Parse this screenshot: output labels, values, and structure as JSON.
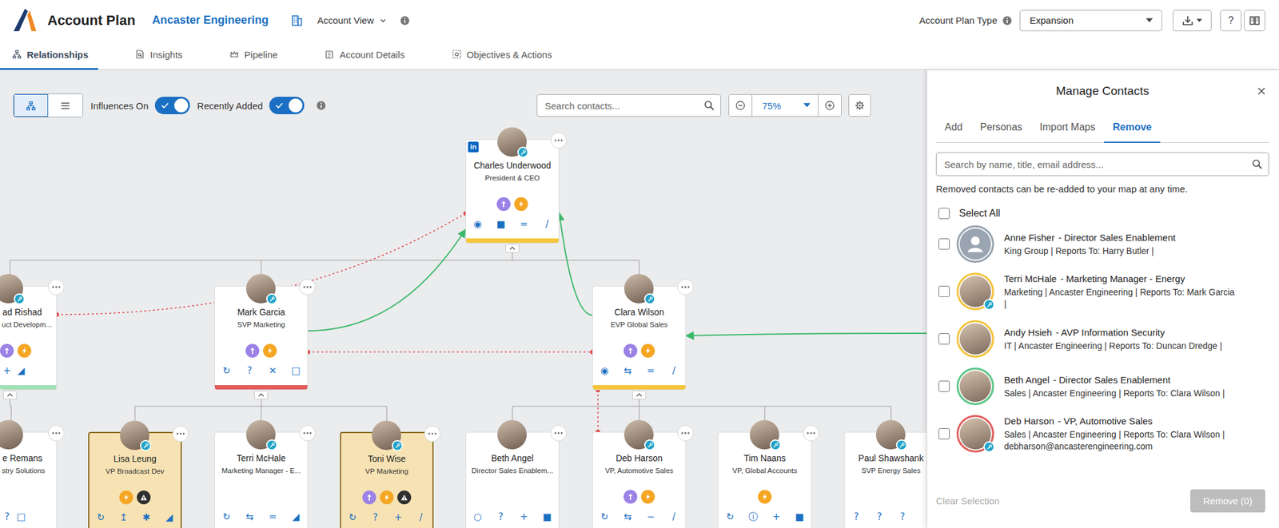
{
  "header": {
    "title": "Account Plan",
    "account": "Ancaster Engineering",
    "view": "Account View",
    "planTypeLabel": "Account Plan Type",
    "planType": "Expansion",
    "help": "?"
  },
  "tabs": [
    {
      "label": "Relationships",
      "selected": true
    },
    {
      "label": "Insights",
      "selected": false
    },
    {
      "label": "Pipeline",
      "selected": false
    },
    {
      "label": "Account Details",
      "selected": false
    },
    {
      "label": "Objectives & Actions",
      "selected": false
    }
  ],
  "toolbar": {
    "views": [
      {
        "kind": "tree",
        "selected": true
      },
      {
        "kind": "list",
        "selected": false
      }
    ],
    "toggles": [
      {
        "label": "Influences On",
        "on": true
      },
      {
        "label": "Recently Added",
        "on": true
      }
    ],
    "search": {
      "placeholder": "Search contacts..."
    },
    "zoom": "75%"
  },
  "canvas": {
    "nodes": [
      {
        "name": "Charles Underwood",
        "title": "President & CEO",
        "linkedin": "in",
        "key": true,
        "recent": false,
        "parent": null,
        "expanded": true,
        "badges": [
          "influence",
          "energy"
        ],
        "actions": [
          "◉",
          "■",
          "=",
          "/"
        ],
        "color": "#f5c63c"
      },
      {
        "name": "ad Rishad",
        "title": "uct Developm...",
        "linkedin": "",
        "key": true,
        "recent": false,
        "parent": 0,
        "expanded": true,
        "badges": [
          "influence",
          "energy"
        ],
        "actions": [
          "+",
          "◢"
        ],
        "color": "#9fe0b4"
      },
      {
        "name": "Mark Garcia",
        "title": "SVP Marketing",
        "linkedin": "",
        "key": true,
        "recent": false,
        "parent": 0,
        "expanded": true,
        "badges": [
          "influence",
          "energy"
        ],
        "actions": [
          "↻",
          "?",
          "✕",
          "□"
        ],
        "color": "#e35d5d"
      },
      {
        "name": "Clara Wilson",
        "title": "EVP Global Sales",
        "linkedin": "",
        "key": true,
        "recent": false,
        "parent": 0,
        "expanded": true,
        "badges": [
          "influence",
          "energy"
        ],
        "actions": [
          "◉",
          "⇆",
          "=",
          "/"
        ],
        "color": "#f5c63c"
      },
      {
        "name": "e Remans",
        "title": "stry Solutions",
        "linkedin": "",
        "key": false,
        "recent": false,
        "parent": 1,
        "expanded": false,
        "badges": [],
        "actions": [
          "?",
          "□"
        ],
        "color": ""
      },
      {
        "name": "Lisa Leung",
        "title": "VP Broadcast Dev",
        "linkedin": "",
        "key": true,
        "recent": true,
        "parent": 2,
        "expanded": false,
        "badges": [
          "energy",
          "warning"
        ],
        "actions": [
          "↻",
          "↥",
          "✱",
          "◢"
        ],
        "color": ""
      },
      {
        "name": "Terri McHale",
        "title": "Marketing Manager - E...",
        "linkedin": "",
        "key": true,
        "recent": false,
        "parent": 2,
        "expanded": false,
        "badges": [],
        "actions": [
          "↻",
          "⇆",
          "=",
          "◢"
        ],
        "color": ""
      },
      {
        "name": "Toni Wise",
        "title": "VP Marketing",
        "linkedin": "",
        "key": true,
        "recent": true,
        "parent": 2,
        "expanded": false,
        "badges": [
          "influence",
          "energy",
          "warning"
        ],
        "actions": [
          "↻",
          "?",
          "+",
          "/"
        ],
        "color": ""
      },
      {
        "name": "Beth Angel",
        "title": "Director Sales Enablem...",
        "linkedin": "",
        "key": false,
        "recent": false,
        "parent": 3,
        "expanded": false,
        "badges": [],
        "actions": [
          "○",
          "?",
          "+",
          "■"
        ],
        "color": ""
      },
      {
        "name": "Deb Harson",
        "title": "VP, Automotive Sales",
        "linkedin": "",
        "key": true,
        "recent": false,
        "parent": 3,
        "expanded": false,
        "badges": [
          "influence",
          "energy"
        ],
        "actions": [
          "↻",
          "⇆",
          "−",
          "/"
        ],
        "color": ""
      },
      {
        "name": "Tim Naans",
        "title": "VP, Global Accounts",
        "linkedin": "",
        "key": true,
        "recent": false,
        "parent": 3,
        "expanded": false,
        "badges": [
          "energy"
        ],
        "actions": [
          "↻",
          "ⓘ",
          "+",
          "■"
        ],
        "color": ""
      },
      {
        "name": "Paul Shawshank",
        "title": "SVP Energy Sales",
        "linkedin": "",
        "key": true,
        "recent": false,
        "parent": 3,
        "expanded": false,
        "badges": [],
        "actions": [
          "?",
          "?",
          "?"
        ],
        "color": ""
      }
    ],
    "influences": [
      {
        "from": 1,
        "to": 0,
        "positive": false,
        "color": "#e04848"
      },
      {
        "from": 2,
        "to": 0,
        "positive": true,
        "color": "#3cb96a"
      },
      {
        "from": 3,
        "to": 0,
        "positive": true,
        "color": "#3cb96a"
      },
      {
        "from": 2,
        "to": 3,
        "positive": false,
        "color": "#e04848"
      },
      {
        "from": null,
        "to": 3,
        "positive": true,
        "color": "#3cb96a"
      },
      {
        "from": 3,
        "to": 9,
        "positive": false,
        "color": "#e04848"
      }
    ]
  },
  "panel": {
    "title": "Manage Contacts",
    "tabs": [
      {
        "label": "Add",
        "selected": false
      },
      {
        "label": "Personas",
        "selected": false
      },
      {
        "label": "Import Maps",
        "selected": false
      },
      {
        "label": "Remove",
        "selected": true
      }
    ],
    "search": {
      "placeholder": "Search by name, title, email address..."
    },
    "note": "Removed contacts can be re-added to your map at any time.",
    "selectAll": {
      "label": "Select All",
      "checked": false
    },
    "contacts": [
      {
        "name": "Anne Fisher",
        "title": "- Director Sales Enablement",
        "details": "King Group | Reports To: Harry Butler |",
        "photo": false,
        "key": false,
        "checked": false,
        "color": "#9aa5b1"
      },
      {
        "name": "Terri McHale",
        "title": "- Marketing Manager - Energy",
        "details": "Marketing | Ancaster Engineering | Reports To: Mark Garcia |",
        "photo": true,
        "key": true,
        "checked": false,
        "color": "#f5c63c"
      },
      {
        "name": "Andy Hsieh",
        "title": "- AVP Information Security",
        "details": "IT | Ancaster Engineering | Reports To: Duncan Dredge |",
        "photo": true,
        "key": false,
        "checked": false,
        "color": "#f5c63c"
      },
      {
        "name": "Beth Angel",
        "title": "- Director Sales Enablement",
        "details": "Sales | Ancaster Engineering | Reports To: Clara Wilson |",
        "photo": true,
        "key": false,
        "checked": false,
        "color": "#5cc98a"
      },
      {
        "name": "Deb Harson",
        "title": "- VP, Automotive Sales",
        "details": "Sales | Ancaster Engineering | Reports To: Clara Wilson | debharson@ancasterengineering.com",
        "photo": true,
        "key": true,
        "checked": false,
        "color": "#e35d5d"
      }
    ],
    "clear": {
      "label": "Clear Selection",
      "disabled": true
    },
    "remove": {
      "label": "Remove (0)",
      "disabled": true
    }
  }
}
